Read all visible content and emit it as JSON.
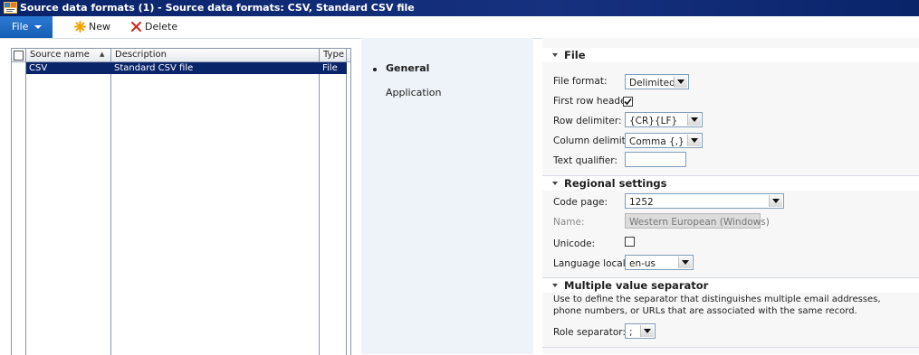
{
  "window": {
    "title": "Source data formats (1) - Source data formats: CSV, Standard CSV file"
  },
  "toolbar": {
    "file_label": "File",
    "new_label": "New",
    "delete_label": "Delete"
  },
  "grid": {
    "columns": [
      "Source name",
      "Description",
      "Type"
    ],
    "rows": [
      {
        "source_name": "CSV",
        "description": "Standard CSV file",
        "type": "File"
      }
    ]
  },
  "nav": {
    "items": [
      "General",
      "Application"
    ],
    "selected": "General"
  },
  "sections": {
    "file": {
      "title": "File",
      "file_format_label": "File format:",
      "file_format_value": "Delimited",
      "first_row_header_label": "First row header:",
      "first_row_header_checked": true,
      "row_delimiter_label": "Row delimiter:",
      "row_delimiter_value": "{CR}{LF}",
      "column_delimiter_label": "Column delimiter:",
      "column_delimiter_value": "Comma {,}",
      "text_qualifier_label": "Text qualifier:",
      "text_qualifier_value": ""
    },
    "regional": {
      "title": "Regional settings",
      "code_page_label": "Code page:",
      "code_page_value": "1252",
      "name_label": "Name:",
      "name_value": "Western European (Windows)",
      "unicode_label": "Unicode:",
      "unicode_checked": false,
      "language_locale_label": "Language locale:",
      "language_locale_value": "en-us"
    },
    "multi": {
      "title": "Multiple value separator",
      "description": "Use to define the separator that distinguishes multiple email addresses, phone numbers, or URLs that are associated with the same record.",
      "role_separator_label": "Role separator:",
      "role_separator_value": ";"
    }
  },
  "colors": {
    "titlebar": "#0a246a",
    "file_button": "#1c6bc4",
    "selected_row": "#0a246a",
    "nav_bg": "#eef3f9"
  },
  "icons": {
    "app": "app-window-icon",
    "new": "new-star-icon",
    "delete": "delete-x-icon"
  }
}
